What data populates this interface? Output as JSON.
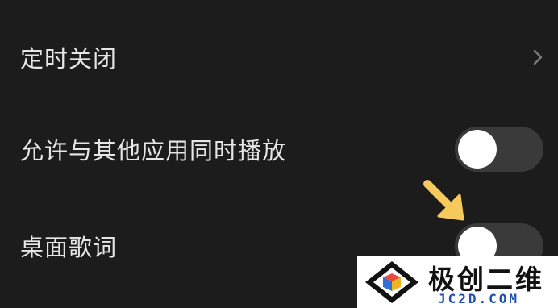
{
  "settings": {
    "items": [
      {
        "label": "定时关闭",
        "control": "chevron",
        "icon": "chevron-right-icon"
      },
      {
        "label": "允许与其他应用同时播放",
        "control": "toggle",
        "state": "off"
      },
      {
        "label": "桌面歌词",
        "control": "toggle",
        "state": "off"
      }
    ]
  },
  "annotation": {
    "icon": "arrow-pointer-icon",
    "color": "#f5c95c"
  },
  "watermark": {
    "title": "极创二维",
    "subtitle": "JC2D.COM"
  },
  "colors": {
    "background": "#1c1c1c",
    "text": "#e6e6e6",
    "toggle_track_off": "#3a3a3a",
    "toggle_knob": "#ffffff",
    "chevron": "#7a7a7a"
  }
}
